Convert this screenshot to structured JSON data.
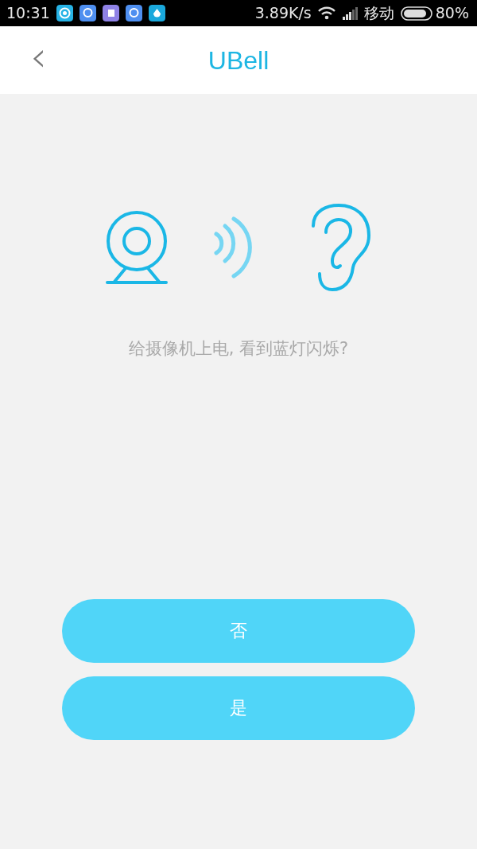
{
  "status_bar": {
    "time": "10:31",
    "net_speed": "3.89K/s",
    "carrier": "移动",
    "battery": "80%"
  },
  "header": {
    "back": "‹",
    "title": "UBell"
  },
  "prompt": "给摄像机上电, 看到蓝灯闪烁?",
  "buttons": [
    {
      "label": "否"
    },
    {
      "label": "是"
    }
  ]
}
